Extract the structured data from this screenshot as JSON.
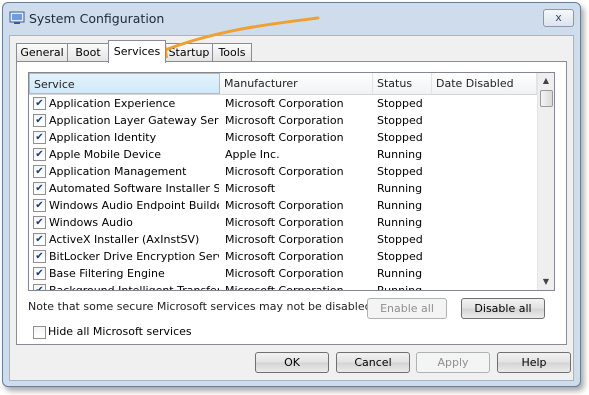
{
  "window": {
    "title": "System Configuration",
    "close_label": "x"
  },
  "tabs": [
    {
      "label": "General"
    },
    {
      "label": "Boot"
    },
    {
      "label": "Services",
      "active": true
    },
    {
      "label": "Startup"
    },
    {
      "label": "Tools"
    }
  ],
  "columns": {
    "service": "Service",
    "manufacturer": "Manufacturer",
    "status": "Status",
    "date_disabled": "Date Disabled"
  },
  "services": [
    {
      "checked": true,
      "name": "Application Experience",
      "manufacturer": "Microsoft Corporation",
      "status": "Stopped",
      "date_disabled": ""
    },
    {
      "checked": true,
      "name": "Application Layer Gateway Service",
      "manufacturer": "Microsoft Corporation",
      "status": "Stopped",
      "date_disabled": ""
    },
    {
      "checked": true,
      "name": "Application Identity",
      "manufacturer": "Microsoft Corporation",
      "status": "Stopped",
      "date_disabled": ""
    },
    {
      "checked": true,
      "name": "Apple Mobile Device",
      "manufacturer": "Apple Inc.",
      "status": "Running",
      "date_disabled": ""
    },
    {
      "checked": true,
      "name": "Application Management",
      "manufacturer": "Microsoft Corporation",
      "status": "Stopped",
      "date_disabled": ""
    },
    {
      "checked": true,
      "name": "Automated Software Installer S...",
      "manufacturer": "Microsoft",
      "status": "Running",
      "date_disabled": ""
    },
    {
      "checked": true,
      "name": "Windows Audio Endpoint Builder",
      "manufacturer": "Microsoft Corporation",
      "status": "Running",
      "date_disabled": ""
    },
    {
      "checked": true,
      "name": "Windows Audio",
      "manufacturer": "Microsoft Corporation",
      "status": "Running",
      "date_disabled": ""
    },
    {
      "checked": true,
      "name": "ActiveX Installer (AxInstSV)",
      "manufacturer": "Microsoft Corporation",
      "status": "Stopped",
      "date_disabled": ""
    },
    {
      "checked": true,
      "name": "BitLocker Drive Encryption Service",
      "manufacturer": "Microsoft Corporation",
      "status": "Stopped",
      "date_disabled": ""
    },
    {
      "checked": true,
      "name": "Base Filtering Engine",
      "manufacturer": "Microsoft Corporation",
      "status": "Running",
      "date_disabled": ""
    },
    {
      "checked": true,
      "name": "Background Intelligent Transfer ...",
      "manufacturer": "Microsoft Corporation",
      "status": "Running",
      "date_disabled": ""
    }
  ],
  "note": "Note that some secure Microsoft services may not be disabled.",
  "buttons": {
    "enable_all": "Enable all",
    "disable_all": "Disable all",
    "ok": "OK",
    "cancel": "Cancel",
    "apply": "Apply",
    "help": "Help"
  },
  "hide_ms_services": {
    "label": "Hide all Microsoft services",
    "checked": false
  },
  "colors": {
    "annotation_arrow": "#f0a030",
    "window_frame": "#cfdcec",
    "header_selected": "#cfe9f9"
  },
  "icons": {
    "app": "system-config-icon",
    "check": "checkmark-icon"
  }
}
